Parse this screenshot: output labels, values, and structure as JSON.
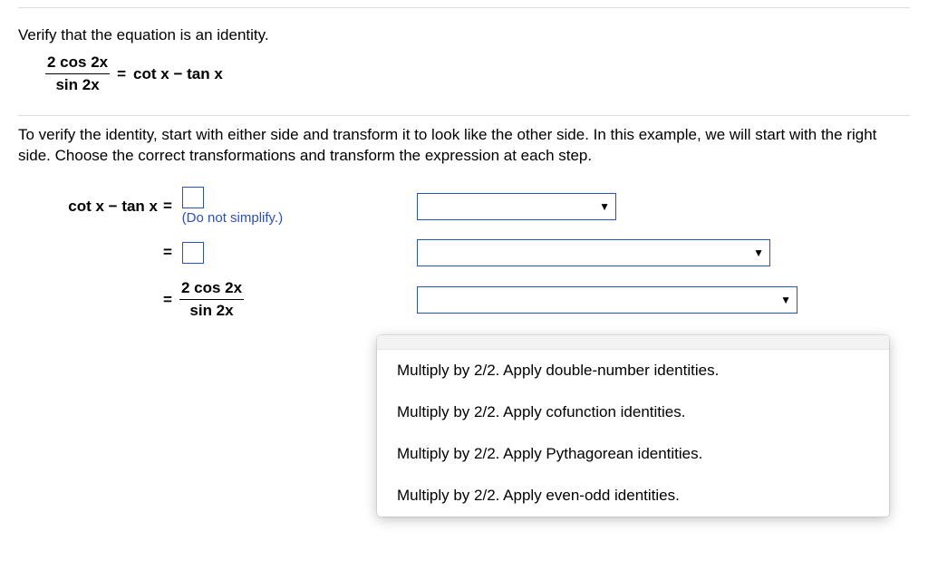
{
  "prompt": "Verify that the equation is an identity.",
  "equation": {
    "lhs_num": "2 cos 2x",
    "lhs_den": "sin  2x",
    "eq": "=",
    "rhs": "cot x − tan x"
  },
  "explain": "To verify the identity, start with either side and transform it to look like the other side. In this example, we will start with the right side. Choose the correct transformations and transform the expression at each step.",
  "steps": {
    "start_label": "cot x −  tan x",
    "eq": "=",
    "hint": "(Do not simplify.)",
    "final_num": "2 cos 2x",
    "final_den": "sin  2x"
  },
  "dropdown3": {
    "options": [
      "Multiply by 2/2. Apply double-number identities.",
      "Multiply by 2/2. Apply cofunction identities.",
      "Multiply by 2/2. Apply Pythagorean identities.",
      "Multiply by 2/2. Apply even-odd identities."
    ]
  }
}
